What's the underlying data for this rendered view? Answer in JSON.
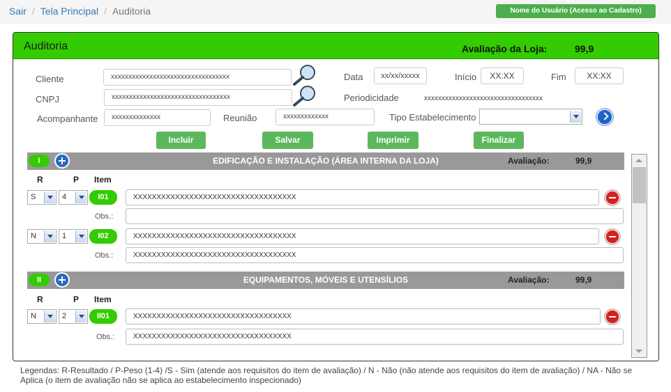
{
  "breadcrumb": {
    "home": "Sair",
    "main": "Tela Principal",
    "current": "Auditoria",
    "separator": "/"
  },
  "user_button": "Nome do Usuário (Acesso ao Cadastro)",
  "panel": {
    "title": "Auditoria",
    "score_label": "Avaliação da Loja:",
    "score_value": "99,9"
  },
  "form": {
    "cliente_label": "Cliente",
    "cliente_value": "xxxxxxxxxxxxxxxxxxxxxxxxxxxxxxxxxx",
    "cnpj_label": "CNPJ",
    "cnpj_value": "xxxxxxxxxxxxxxxxxxxxxxxxxxxxxxxxxx",
    "acomp_label": "Acompanhante",
    "acomp_value": "xxxxxxxxxxxxxx",
    "reuniao_label": "Reunião",
    "reuniao_value": "xxxxxxxxxxxxx",
    "data_label": "Data",
    "data_value": "xx/xx/xxxxx",
    "inicio_label": "Início",
    "inicio_value": "XX:XX",
    "fim_label": "Fim",
    "fim_value": "XX:XX",
    "periodicidade_label": "Periodicidade",
    "periodicidade_value": "xxxxxxxxxxxxxxxxxxxxxxxxxxxxxxxxxx",
    "tipo_label": "Tipo Estabelecimento",
    "tipo_value": ""
  },
  "actions": {
    "incluir": "Incluir",
    "salvar": "Salvar",
    "imprimir": "Imprimir",
    "finalizar": "Finalizar"
  },
  "columns": {
    "r": "R",
    "p": "P",
    "item": "Item"
  },
  "obs_label": "Obs.:",
  "sections": [
    {
      "code": "I",
      "title": "EDIFICAÇÃO E INSTALAÇÃO (ÁREA INTERNA DA LOJA)",
      "eval_label": "Avaliação:",
      "eval_value": "99,9",
      "items": [
        {
          "r": "S",
          "p": "4",
          "code": "I01",
          "text": "XXXXXXXXXXXXXXXXXXXXXXXXXXXXXXXXXXX",
          "obs": ""
        },
        {
          "r": "N",
          "p": "1",
          "code": "I02",
          "text": "XXXXXXXXXXXXXXXXXXXXXXXXXXXXXXXXXXX",
          "obs": "XXXXXXXXXXXXXXXXXXXXXXXXXXXXXXXXXXX"
        }
      ]
    },
    {
      "code": "II",
      "title": "EQUIPAMENTOS, MÓVEIS E UTENSÍLIOS",
      "eval_label": "Avaliação:",
      "eval_value": "99,9",
      "items": [
        {
          "r": "N",
          "p": "2",
          "code": "II01",
          "text": "XXXXXXXXXXXXXXXXXXXXXXXXXXXXXXXXXX",
          "obs": "XXXXXXXXXXXXXXXXXXXXXXXXXXXXXXXXXX"
        }
      ]
    }
  ],
  "legend": "Legendas: R-Resultado / P-Peso (1-4) /S - Sim (atende aos requisitos do item de avaliação) / N - Não (não atende aos requisitos do item de avaliação) / NA - Não se Aplica (o item de avaliação não se aplica ao estabelecimento inspecionado)",
  "icons": {
    "search": "magnifier-icon",
    "go": "arrow-right-circle-icon",
    "add": "plus-circle-icon",
    "remove": "minus-circle-icon"
  },
  "colors": {
    "accent_green": "#33cc00",
    "button_green": "#5cb85c",
    "section_gray": "#999999",
    "remove_red": "#d42020"
  }
}
